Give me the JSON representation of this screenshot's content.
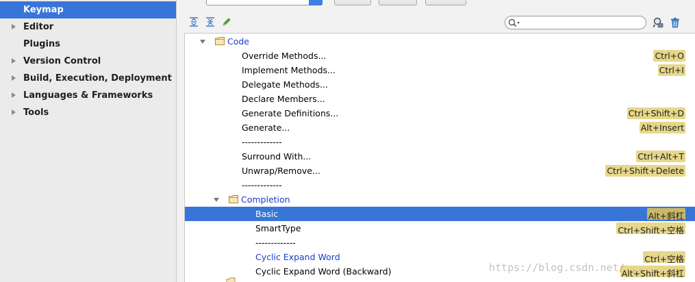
{
  "sidebar": {
    "items": [
      {
        "label": "Keymap",
        "expandable": false,
        "selected": true
      },
      {
        "label": "Editor",
        "expandable": true,
        "selected": false
      },
      {
        "label": "Plugins",
        "expandable": false,
        "selected": false
      },
      {
        "label": "Version Control",
        "expandable": true,
        "selected": false
      },
      {
        "label": "Build, Execution, Deployment",
        "expandable": true,
        "selected": false
      },
      {
        "label": "Languages & Frameworks",
        "expandable": true,
        "selected": false
      },
      {
        "label": "Tools",
        "expandable": true,
        "selected": false
      }
    ]
  },
  "toolbar": {
    "expand_icon": "expand-all-icon",
    "collapse_icon": "collapse-all-icon",
    "edit_icon": "pencil-icon",
    "find_shortcut_icon": "find-shortcut-icon",
    "delete_icon": "trash-icon",
    "search": {
      "value": "",
      "placeholder": ""
    }
  },
  "tree": {
    "rows": [
      {
        "label": "Code",
        "level": 0,
        "type": "folder",
        "shortcut": ""
      },
      {
        "label": "Override Methods...",
        "level": 1,
        "type": "action",
        "shortcut": "Ctrl+O"
      },
      {
        "label": "Implement Methods...",
        "level": 1,
        "type": "action",
        "shortcut": "Ctrl+I"
      },
      {
        "label": "Delegate Methods...",
        "level": 1,
        "type": "action",
        "shortcut": ""
      },
      {
        "label": "Declare Members...",
        "level": 1,
        "type": "action",
        "shortcut": ""
      },
      {
        "label": "Generate Definitions...",
        "level": 1,
        "type": "action",
        "shortcut": "Ctrl+Shift+D"
      },
      {
        "label": "Generate...",
        "level": 1,
        "type": "action",
        "shortcut": "Alt+Insert"
      },
      {
        "label": "-------------",
        "level": 1,
        "type": "separator",
        "shortcut": ""
      },
      {
        "label": "Surround With...",
        "level": 1,
        "type": "action",
        "shortcut": "Ctrl+Alt+T"
      },
      {
        "label": "Unwrap/Remove...",
        "level": 1,
        "type": "action",
        "shortcut": "Ctrl+Shift+Delete"
      },
      {
        "label": "-------------",
        "level": 1,
        "type": "separator",
        "shortcut": ""
      },
      {
        "label": "Completion",
        "level": 1,
        "type": "folder",
        "shortcut": ""
      },
      {
        "label": "Basic",
        "level": 2,
        "type": "action",
        "shortcut": "Alt+斜杠",
        "selected": true
      },
      {
        "label": "SmartType",
        "level": 2,
        "type": "action",
        "shortcut": "Ctrl+Shift+空格"
      },
      {
        "label": "-------------",
        "level": 2,
        "type": "separator",
        "shortcut": ""
      },
      {
        "label": "Cyclic Expand Word",
        "level": 2,
        "type": "action",
        "shortcut": "Ctrl+空格",
        "blue": true
      },
      {
        "label": "Cyclic Expand Word (Backward)",
        "level": 2,
        "type": "action",
        "shortcut": "Alt+Shift+斜杠"
      }
    ]
  },
  "watermark": "https://blog.csdn.net/...",
  "colors": {
    "selection": "#3875d7",
    "shortcut_bg": "#e6d78a",
    "link_blue": "#1a3cc7"
  }
}
